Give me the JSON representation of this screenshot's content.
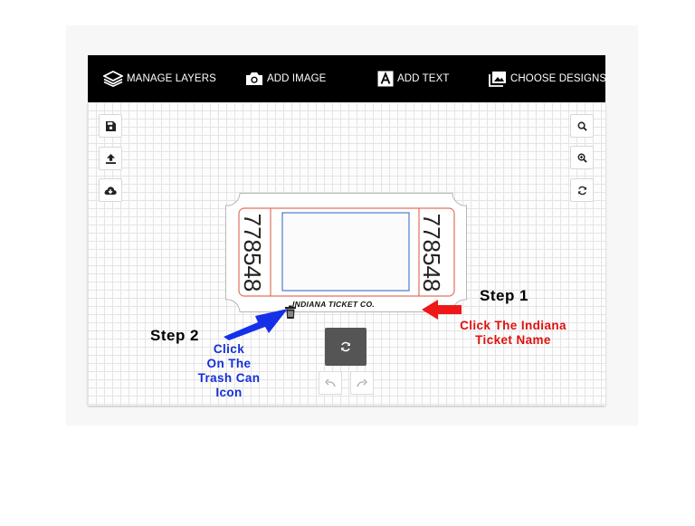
{
  "toolbar": {
    "manage_layers": "MANAGE LAYERS",
    "add_image": "ADD IMAGE",
    "add_text": "ADD TEXT",
    "choose_designs": "CHOOSE DESIGNS"
  },
  "left_tools": [
    "save-icon",
    "upload-icon",
    "cloud-download-icon"
  ],
  "right_tools": [
    "search-icon",
    "zoom-in-icon",
    "refresh-icon"
  ],
  "ticket": {
    "stub_number_left": "778548",
    "stub_number_right": "778548",
    "company_name": "INDIANA TICKET CO."
  },
  "annotations": {
    "step1_title": "Step 1",
    "step1_line1": "Click The Indiana",
    "step1_line2": "Ticket Name",
    "step2_title": "Step 2",
    "step2_line1": "Click",
    "step2_line2": "On The",
    "step2_line3": "Trash Can",
    "step2_line4": "Icon"
  },
  "colors": {
    "toolbar_bg": "#000000",
    "annotation_red": "#e01010",
    "annotation_blue": "#1530d8",
    "ticket_border": "#e07060",
    "ticket_inner_border": "#4a7bd0"
  }
}
